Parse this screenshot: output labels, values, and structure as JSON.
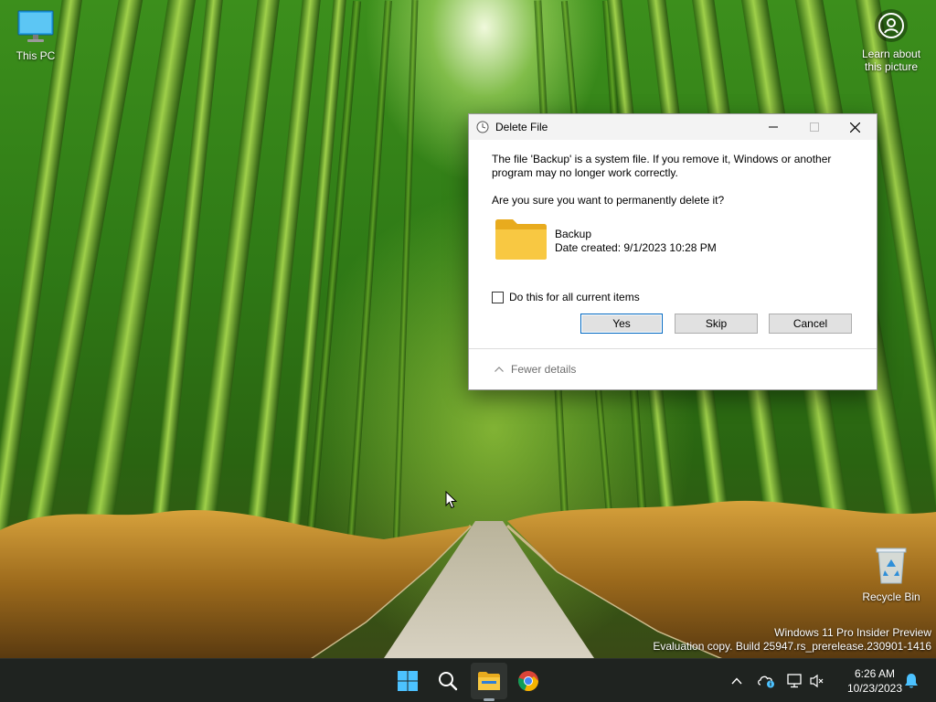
{
  "desktop": {
    "icons": [
      {
        "label": "This PC"
      },
      {
        "label": "Recycle Bin"
      }
    ],
    "learn_about_picture": {
      "line1": "Learn about",
      "line2": "this picture"
    },
    "watermark": {
      "line1": "Windows 11 Pro Insider Preview",
      "line2": "Evaluation copy. Build 25947.rs_prerelease.230901-1416"
    }
  },
  "dialog": {
    "title": "Delete File",
    "message_line1": "The file 'Backup' is a system file. If you remove it, Windows or another",
    "message_line2": "program may no longer work correctly.",
    "question": "Are you sure you want to permanently delete it?",
    "file": {
      "name": "Backup",
      "date": "Date created: 9/1/2023 10:28 PM"
    },
    "checkbox_label": "Do this for all current items",
    "checkbox_checked": false,
    "buttons": {
      "yes": "Yes",
      "skip": "Skip",
      "cancel": "Cancel"
    },
    "details_toggle": "Fewer details"
  },
  "taskbar": {
    "pinned": [
      "start-icon",
      "search-icon",
      "file-explorer-icon",
      "chrome-icon"
    ],
    "clock": {
      "time": "6:26 AM",
      "date": "10/23/2023"
    }
  },
  "colors": {
    "accent": "#0067c0",
    "taskbar": "#1f2320",
    "folder": "#f8c842"
  }
}
